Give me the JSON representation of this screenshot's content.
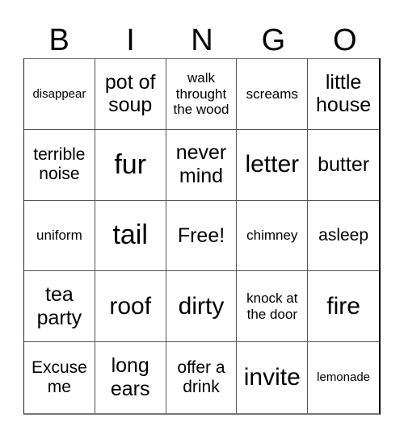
{
  "header": {
    "letters": [
      "B",
      "I",
      "N",
      "G",
      "O"
    ]
  },
  "grid": {
    "rows": [
      [
        "disappear",
        "pot of soup",
        "walk throught the wood",
        "screams",
        "little house"
      ],
      [
        "terrible noise",
        "fur",
        "never mind",
        "letter",
        "butter"
      ],
      [
        "uniform",
        "tail",
        "Free!",
        "chimney",
        "asleep"
      ],
      [
        "tea party",
        "roof",
        "dirty",
        "knock at the door",
        "fire"
      ],
      [
        "Excuse me",
        "long ears",
        "offer a drink",
        "invite",
        "lemonade"
      ]
    ]
  }
}
